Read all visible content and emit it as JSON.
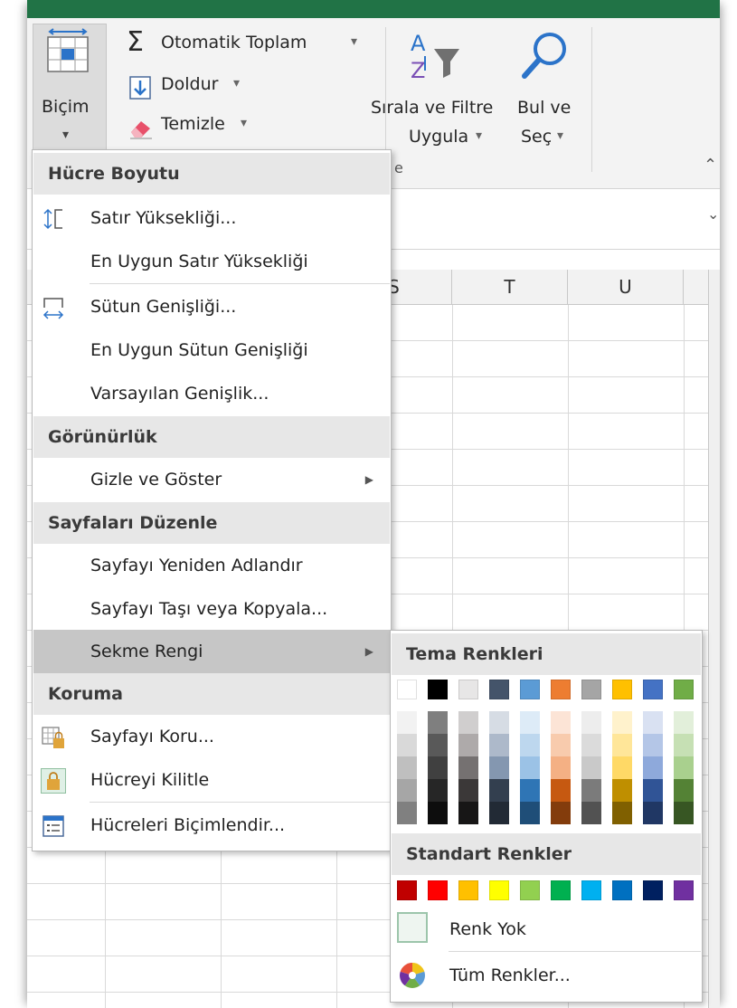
{
  "ribbon": {
    "autosum_label": "Otomatik Toplam",
    "fill_label": "Doldur",
    "clear_label": "Temizle",
    "format_label": "Biçim",
    "sort_filter_line1": "Sırala ve Filtre",
    "sort_filter_line2": "Uygula",
    "find_line1": "Bul ve",
    "find_line2": "Seç",
    "group_label_fragment": "e",
    "dropdown_caret": "▾",
    "collapse_caret": "⌃",
    "formula_caret": "⌄"
  },
  "columns": [
    "S",
    "T",
    "U"
  ],
  "menu": {
    "cell_size_header": "Hücre Boyutu",
    "row_height": "Satır Yüksekliği...",
    "autofit_row_height": "En Uygun Satır Yüksekliği",
    "column_width": "Sütun Genişliği...",
    "autofit_column_width": "En Uygun Sütun Genişliği",
    "default_width": "Varsayılan Genişlik...",
    "visibility_header": "Görünürlük",
    "hide_unhide": "Gizle ve Göster",
    "organize_sheets_header": "Sayfaları Düzenle",
    "rename_sheet": "Sayfayı Yeniden Adlandır",
    "move_copy_sheet": "Sayfayı Taşı veya Kopyala...",
    "tab_color": "Sekme Rengi",
    "protection_header": "Koruma",
    "protect_sheet": "Sayfayı Koru...",
    "lock_cell": "Hücreyi Kilitle",
    "format_cells": "Hücreleri Biçimlendir...",
    "submenu_arrow": "▶"
  },
  "submenu": {
    "theme_colors_header": "Tema Renkleri",
    "standard_colors_header": "Standart Renkler",
    "no_color": "Renk Yok",
    "more_colors": "Tüm Renkler...",
    "theme_colors": [
      "#FFFFFF",
      "#000000",
      "#E7E6E6",
      "#44546A",
      "#5B9BD5",
      "#ED7D31",
      "#A5A5A5",
      "#FFC000",
      "#4472C4",
      "#70AD47"
    ],
    "theme_shades": [
      [
        "#F2F2F2",
        "#D9D9D9",
        "#BFBFBF",
        "#A6A6A6",
        "#808080"
      ],
      [
        "#7F7F7F",
        "#595959",
        "#404040",
        "#262626",
        "#0D0D0D"
      ],
      [
        "#D0CECE",
        "#AEAAAA",
        "#757171",
        "#3B3838",
        "#171616"
      ],
      [
        "#D6DCE4",
        "#ADB9CA",
        "#8497B0",
        "#333F4F",
        "#222A35"
      ],
      [
        "#DDEBF7",
        "#BDD7EE",
        "#9BC2E6",
        "#2F75B5",
        "#1F4E78"
      ],
      [
        "#FCE4D6",
        "#F8CBAD",
        "#F4B084",
        "#C65911",
        "#833C0C"
      ],
      [
        "#EDEDED",
        "#DBDBDB",
        "#C9C9C9",
        "#7B7B7B",
        "#525252"
      ],
      [
        "#FFF2CC",
        "#FFE699",
        "#FFD966",
        "#BF8F00",
        "#806000"
      ],
      [
        "#D9E1F2",
        "#B4C6E7",
        "#8EA9DB",
        "#305496",
        "#203764"
      ],
      [
        "#E2EFDA",
        "#C6E0B4",
        "#A9D08E",
        "#548235",
        "#375623"
      ]
    ],
    "standard_colors": [
      "#C00000",
      "#FF0000",
      "#FFC000",
      "#FFFF00",
      "#92D050",
      "#00B050",
      "#00B0F0",
      "#0070C0",
      "#002060",
      "#7030A0"
    ]
  }
}
